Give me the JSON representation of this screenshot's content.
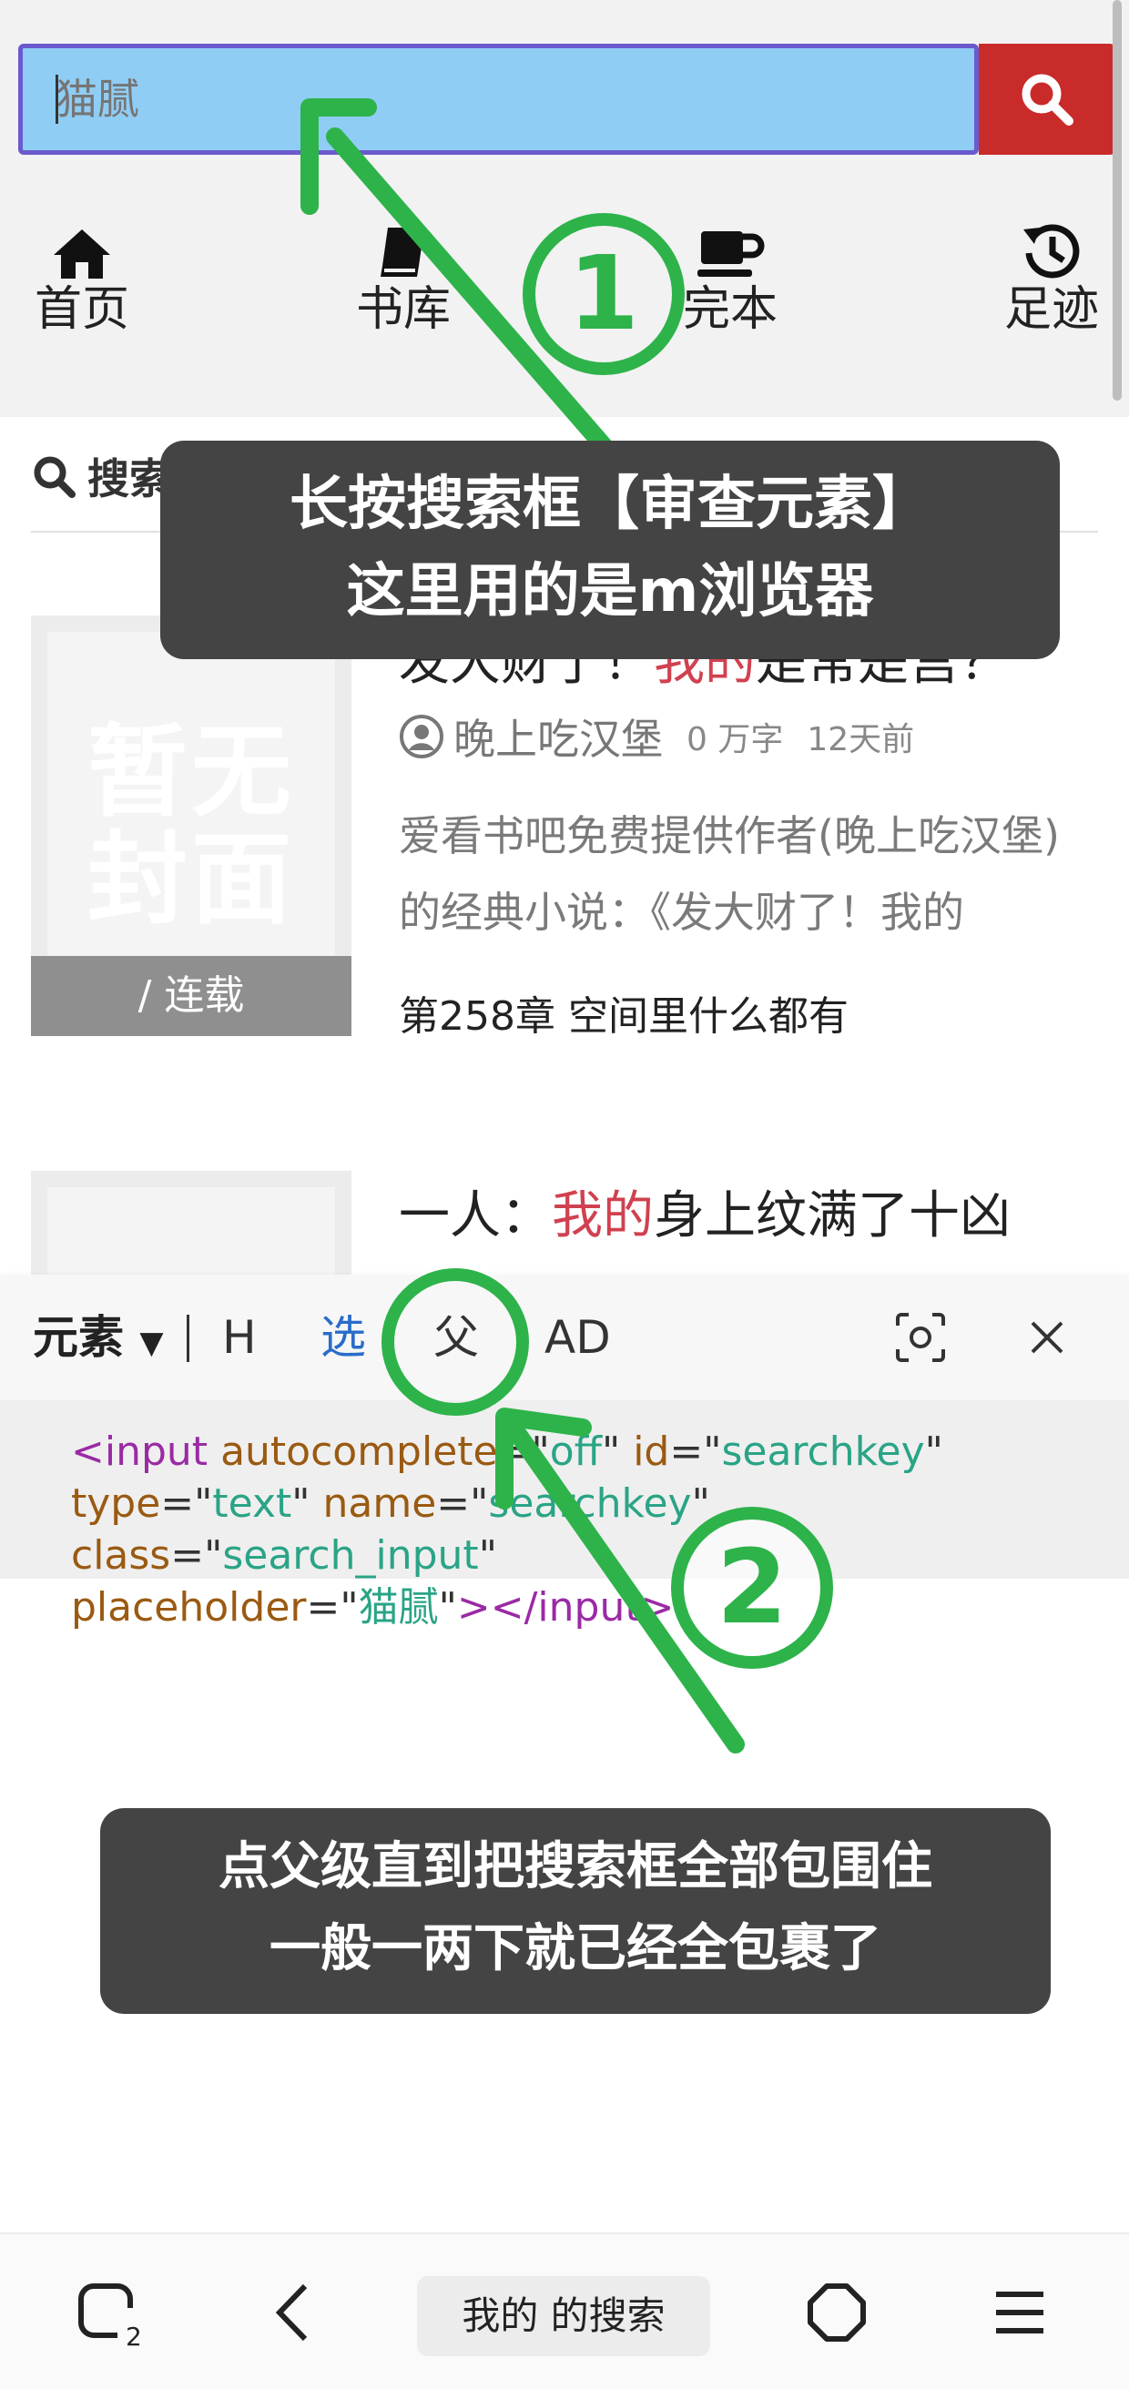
{
  "search": {
    "placeholder": "猫腻"
  },
  "nav": [
    {
      "label": "首页",
      "icon": "home-icon"
    },
    {
      "label": "书库",
      "icon": "book-icon"
    },
    {
      "label": "完本",
      "icon": "coffee-cup-icon"
    },
    {
      "label": "足迹",
      "icon": "history-icon"
    }
  ],
  "section": {
    "label": "搜索"
  },
  "books": [
    {
      "title_prefix": "发大财了！",
      "title_highlight": "我的",
      "title_suffix": "是常是宫？",
      "cover_text": "暂无封面",
      "badge": "/ 连载",
      "author": "晚上吃汉堡",
      "words": "0 万字",
      "updated": "12天前",
      "description": "爱看书吧免费提供作者(晚上吃汉堡)的经典小说：《发大财了！我的",
      "latest_chapter": "第258章 空间里什么都有"
    },
    {
      "title_prefix": "一人：",
      "title_highlight": "我的",
      "title_suffix": "身上纹满了十凶"
    }
  ],
  "inspector": {
    "mode": "元素",
    "h": "H",
    "select": "选",
    "parent": "父",
    "ad": "AD",
    "code": {
      "lt": "<",
      "tag": "input",
      "attr1": "autocomplete",
      "val1": "off",
      "attr2": "id",
      "val2": "searchkey",
      "attr3": "type",
      "val3": "text",
      "attr4": "name",
      "val4": "searchkey",
      "attr5": "class",
      "val5": "search_input",
      "attr6": "placeholder",
      "val6": "猫腻",
      "close": "></input>"
    }
  },
  "annotations": {
    "step1": "1",
    "step2": "2",
    "callout1": [
      "长按搜索框【审查元素】",
      "这里用的是m浏览器"
    ],
    "callout2": [
      "点父级直到把搜索框全部包围住",
      "一般一两下就已经全包裹了"
    ],
    "accent_color": "#2db34a"
  },
  "bottom_bar": {
    "tab_count": "2",
    "search_pill": "我的 的搜索"
  }
}
